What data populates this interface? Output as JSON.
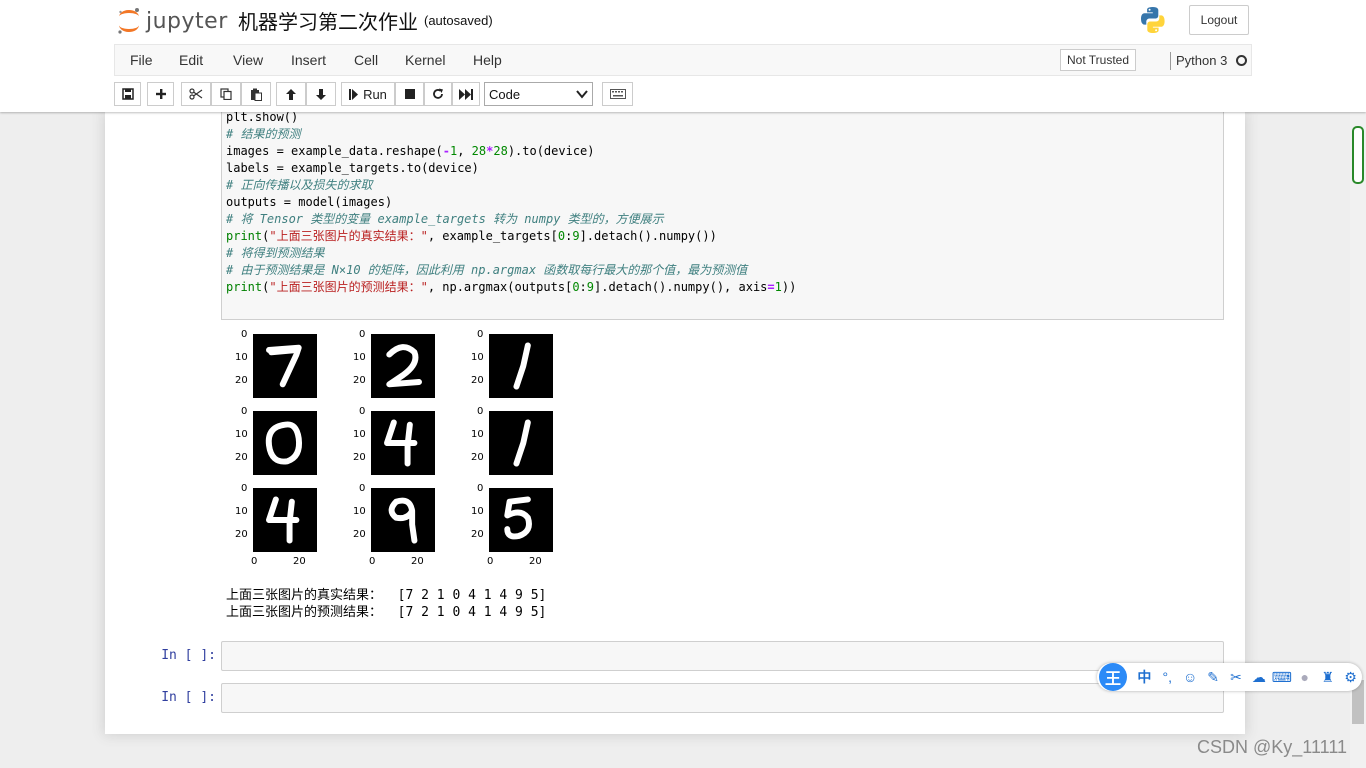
{
  "header": {
    "logo_text": "jupyter",
    "notebook_title": "机器学习第二次作业",
    "autosave_status": "(autosaved)",
    "logout_label": "Logout"
  },
  "menu": {
    "items": [
      "File",
      "Edit",
      "View",
      "Insert",
      "Cell",
      "Kernel",
      "Help"
    ],
    "not_trusted": "Not Trusted",
    "kernel_name": "Python 3"
  },
  "toolbar": {
    "run_label": "Run",
    "cell_type": "Code",
    "buttons": [
      "save-icon",
      "plus-icon",
      "scissors-icon",
      "copy-icon",
      "paste-icon",
      "arrow-up-icon",
      "arrow-down-icon",
      "run-icon",
      "stop-icon",
      "restart-icon",
      "fast-forward-icon",
      "keyboard-icon"
    ]
  },
  "code": {
    "lines": [
      [
        {
          "t": "plt.show()",
          "c": ""
        }
      ],
      [
        {
          "t": "# 结果的预测",
          "c": "cm-comment"
        }
      ],
      [
        {
          "t": "images = example_data.reshape(",
          "c": ""
        },
        {
          "t": "-",
          "c": "cm-op"
        },
        {
          "t": "1",
          "c": "cm-number"
        },
        {
          "t": ", ",
          "c": ""
        },
        {
          "t": "28",
          "c": "cm-number"
        },
        {
          "t": "*",
          "c": "cm-op"
        },
        {
          "t": "28",
          "c": "cm-number"
        },
        {
          "t": ").to(device)",
          "c": ""
        }
      ],
      [
        {
          "t": "labels = example_targets.to(device)",
          "c": ""
        }
      ],
      [
        {
          "t": "# 正向传播以及损失的求取",
          "c": "cm-comment"
        }
      ],
      [
        {
          "t": "outputs = model(images)",
          "c": ""
        }
      ],
      [
        {
          "t": "# 将 Tensor 类型的变量 example_targets 转为 numpy 类型的，方便展示",
          "c": "cm-comment"
        }
      ],
      [
        {
          "t": "print",
          "c": "cm-builtin"
        },
        {
          "t": "(",
          "c": ""
        },
        {
          "t": "\"上面三张图片的真实结果：\"",
          "c": "cm-string"
        },
        {
          "t": ", example_targets[",
          "c": ""
        },
        {
          "t": "0",
          "c": "cm-number"
        },
        {
          "t": ":",
          "c": ""
        },
        {
          "t": "9",
          "c": "cm-number"
        },
        {
          "t": "].detach().numpy())",
          "c": ""
        }
      ],
      [
        {
          "t": "# 将得到预测结果",
          "c": "cm-comment"
        }
      ],
      [
        {
          "t": "# 由于预测结果是 N×10 的矩阵，因此利用 np.argmax 函数取每行最大的那个值，最为预测值",
          "c": "cm-comment"
        }
      ],
      [
        {
          "t": "print",
          "c": "cm-builtin"
        },
        {
          "t": "(",
          "c": ""
        },
        {
          "t": "\"上面三张图片的预测结果：\"",
          "c": "cm-string"
        },
        {
          "t": ", np.argmax(outputs[",
          "c": ""
        },
        {
          "t": "0",
          "c": "cm-number"
        },
        {
          "t": ":",
          "c": ""
        },
        {
          "t": "9",
          "c": "cm-number"
        },
        {
          "t": "].detach().numpy(), axis",
          "c": ""
        },
        {
          "t": "=",
          "c": "cm-op"
        },
        {
          "t": "1",
          "c": "cm-number"
        },
        {
          "t": "))",
          "c": ""
        }
      ]
    ]
  },
  "figure": {
    "digits": [
      "7",
      "2",
      "1",
      "0",
      "4",
      "1",
      "4",
      "9",
      "5"
    ],
    "y_ticks": [
      "0",
      "10",
      "20"
    ],
    "x_ticks": [
      "0",
      "20"
    ]
  },
  "output": {
    "line1": "上面三张图片的真实结果：  [7 2 1 0 4 1 4 9 5]",
    "line2": "上面三张图片的预测结果：  [7 2 1 0 4 1 4 9 5]"
  },
  "empty_cells": [
    {
      "prompt": "In [ ]:"
    },
    {
      "prompt": "In [ ]:"
    }
  ],
  "ime": {
    "logo": "王",
    "mode": "中"
  },
  "watermark": "CSDN @Ky_11111"
}
